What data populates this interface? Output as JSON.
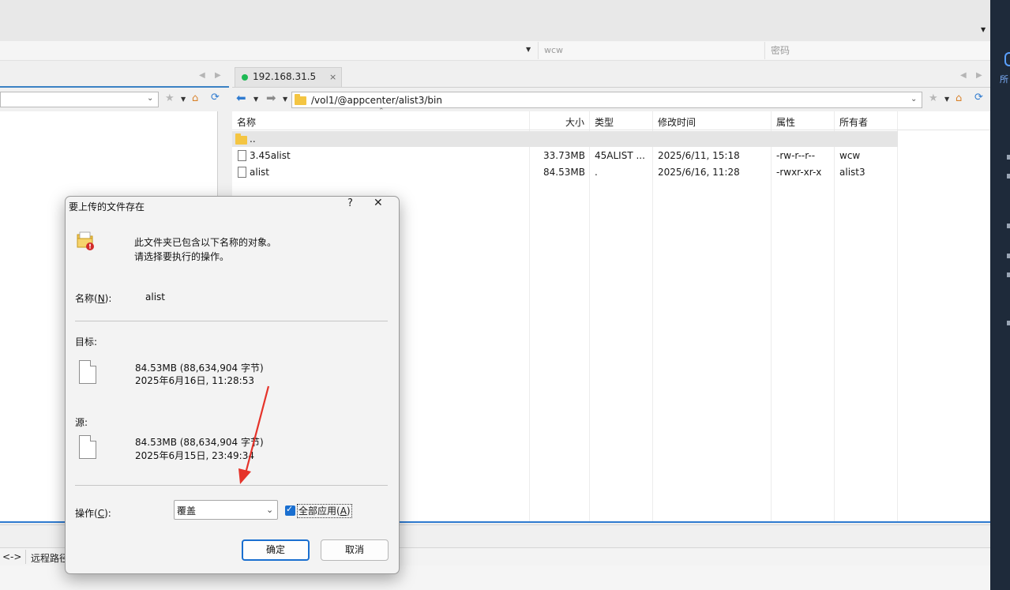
{
  "connection": {
    "username": "wcw",
    "password_placeholder": "密码"
  },
  "side_panel": {
    "label": "所"
  },
  "tabs": {
    "active_label": "192.168.31.5",
    "close_glyph": "×",
    "status_color": "#1db954"
  },
  "remote": {
    "path": "/vol1/@appcenter/alist3/bin",
    "columns": {
      "name": "名称",
      "size": "大小",
      "type": "类型",
      "modified": "修改时间",
      "attributes": "属性",
      "owner": "所有者"
    },
    "parent_row": "..",
    "files": [
      {
        "name": "3.45alist",
        "size": "33.73MB",
        "type": "45ALIST ...",
        "modified": "2025/6/11, 15:18",
        "attributes": "-rw-r--r--",
        "owner": "wcw"
      },
      {
        "name": "alist",
        "size": "84.53MB",
        "type": ".",
        "modified": "2025/6/16, 11:28",
        "attributes": "-rwxr-xr-x",
        "owner": "alist3"
      }
    ]
  },
  "bottom": {
    "direction_symbol": "<->",
    "remote_path_label": "远程路径"
  },
  "dialog": {
    "title": "要上传的文件存在",
    "help": "?",
    "message_line1": "此文件夹已包含以下名称的对象。",
    "message_line2": "请选择要执行的操作。",
    "name_label_pre": "名称(",
    "name_label_key": "N",
    "name_label_post": "):",
    "name_value": "alist",
    "target_label": "目标:",
    "target_size": "84.53MB (88,634,904 字节)",
    "target_date": "2025年6月16日, 11:28:53",
    "source_label": "源:",
    "source_size": "84.53MB (88,634,904 字节)",
    "source_date": "2025年6月15日, 23:49:34",
    "action_label_pre": "操作(",
    "action_label_key": "C",
    "action_label_post": "):",
    "action_selected": "覆盖",
    "apply_all_pre": "全部应用(",
    "apply_all_key": "A",
    "apply_all_post": ")",
    "apply_all_checked": true,
    "ok_label": "确定",
    "cancel_label": "取消"
  }
}
